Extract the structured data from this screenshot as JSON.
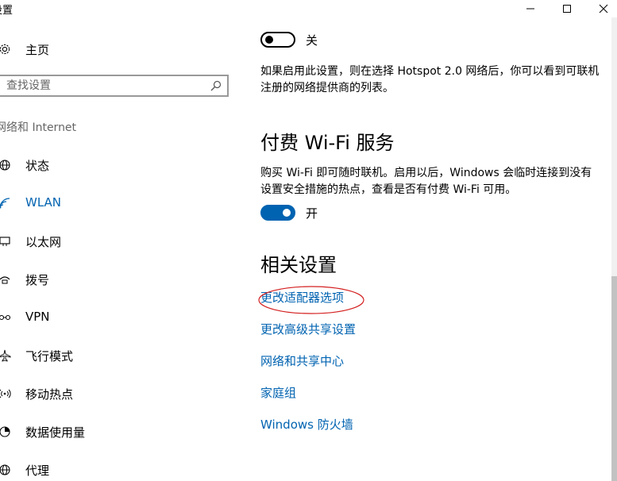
{
  "window": {
    "title": "设置",
    "minimize_icon": "minimize-icon",
    "maximize_icon": "maximize-icon",
    "close_icon": "close-icon"
  },
  "sidebar": {
    "home": {
      "label": "主页",
      "icon": "gear-icon"
    },
    "search": {
      "placeholder": "查找设置",
      "icon": "search-icon"
    },
    "section_title": "网络和 Internet",
    "items": [
      {
        "label": "状态",
        "icon": "globe-icon",
        "active": false
      },
      {
        "label": "WLAN",
        "icon": "wifi-icon",
        "active": true
      },
      {
        "label": "以太网",
        "icon": "ethernet-icon",
        "active": false
      },
      {
        "label": "拨号",
        "icon": "dialup-icon",
        "active": false
      },
      {
        "label": "VPN",
        "icon": "vpn-icon",
        "active": false
      },
      {
        "label": "飞行模式",
        "icon": "airplane-icon",
        "active": false
      },
      {
        "label": "移动热点",
        "icon": "hotspot-icon",
        "active": false
      },
      {
        "label": "数据使用量",
        "icon": "data-usage-icon",
        "active": false
      },
      {
        "label": "代理",
        "icon": "globe-icon",
        "active": false
      }
    ]
  },
  "content": {
    "hotspot_toggle": {
      "state_label": "关",
      "on": false
    },
    "hotspot_desc": "如果启用此设置，则在选择 Hotspot 2.0 网络后，你可以看到可联机注册的网络提供商的列表。",
    "paid_wifi": {
      "title": "付费 Wi-Fi 服务",
      "desc": "购买 Wi-Fi 即可随时联机。启用以后，Windows 会临时连接到没有设置安全措施的热点，查看是否有付费 Wi-Fi 可用。",
      "toggle_label": "开",
      "on": true
    },
    "related": {
      "title": "相关设置",
      "links": [
        "更改适配器选项",
        "更改高级共享设置",
        "网络和共享中心",
        "家庭组",
        "Windows 防火墙"
      ]
    }
  },
  "colors": {
    "accent": "#0063b1",
    "annotation": "#d42020",
    "text": "#000000",
    "muted": "#666666"
  }
}
